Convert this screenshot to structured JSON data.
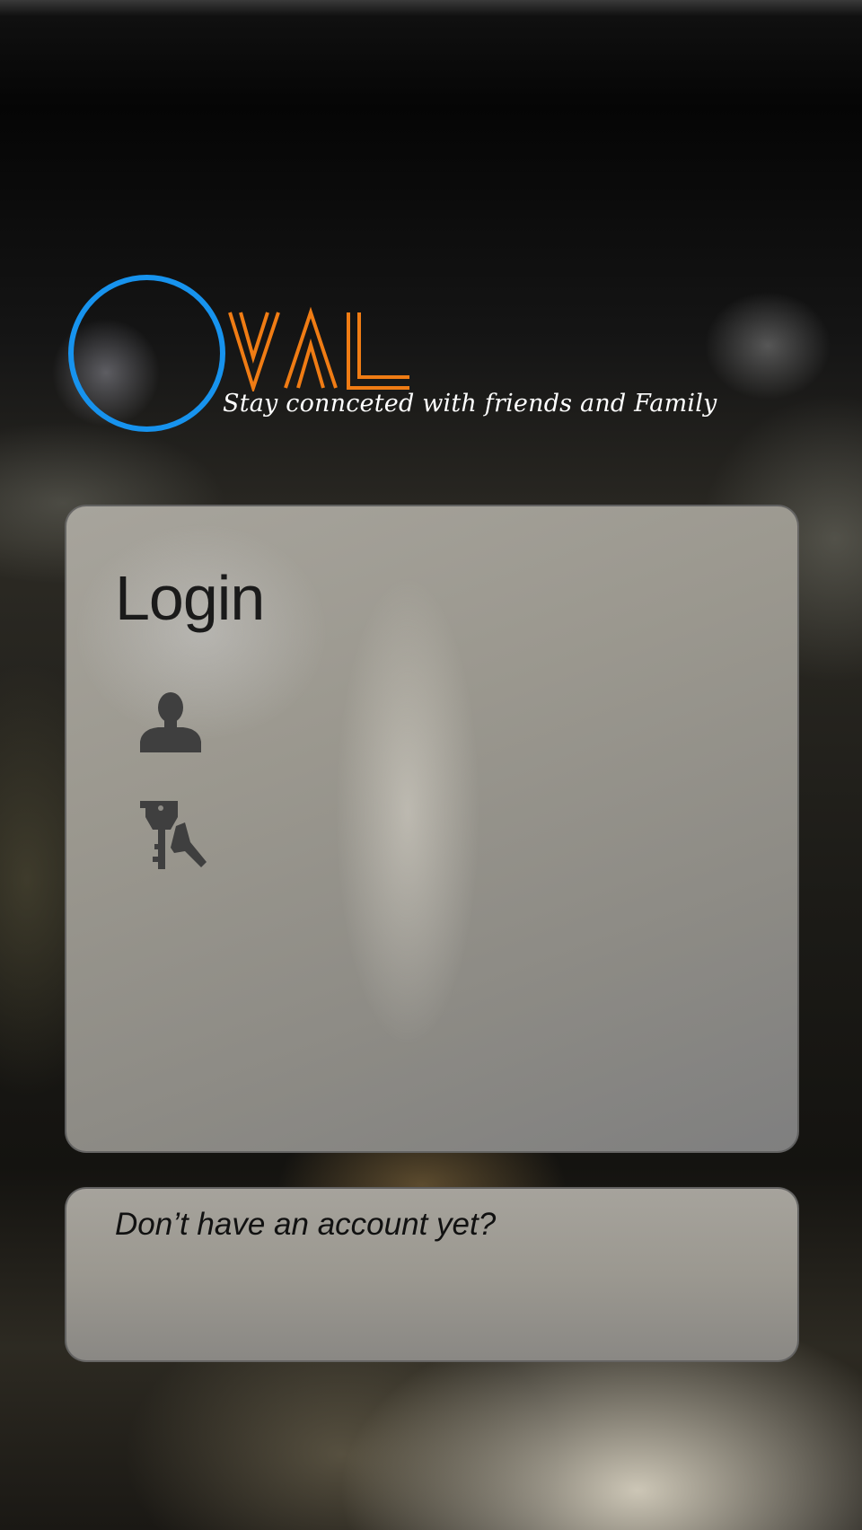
{
  "brand": {
    "wordmark": "VAL",
    "tagline": "Stay connceted with friends and Family",
    "ring_color": "#1793ee",
    "wordmark_color": "#f07c14"
  },
  "login": {
    "title": "Login",
    "username_icon": "user-icon",
    "password_icon": "keys-icon"
  },
  "signup": {
    "prompt": "Don’t have an account yet?"
  }
}
